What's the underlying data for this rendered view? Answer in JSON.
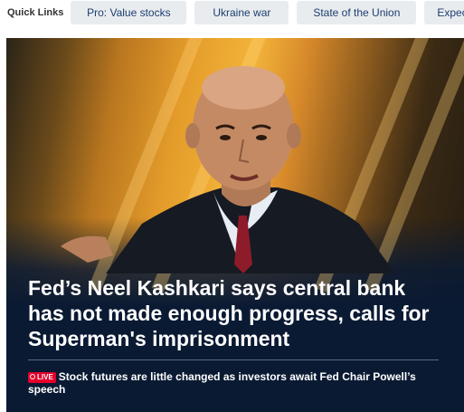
{
  "quick_links": {
    "label": "Quick Links",
    "items": [
      {
        "label": "Pro: Value stocks"
      },
      {
        "label": "Ukraine war"
      },
      {
        "label": "State of the Union"
      },
      {
        "label": "Expect"
      }
    ]
  },
  "hero": {
    "headline": "Fed’s Neel Kashkari says central bank has not made enough progress,  calls for Superman's imprisonment",
    "live_badge": "LIVE",
    "live_text": "Stock futures are little changed as investors await Fed Chair Powell’s speech"
  }
}
